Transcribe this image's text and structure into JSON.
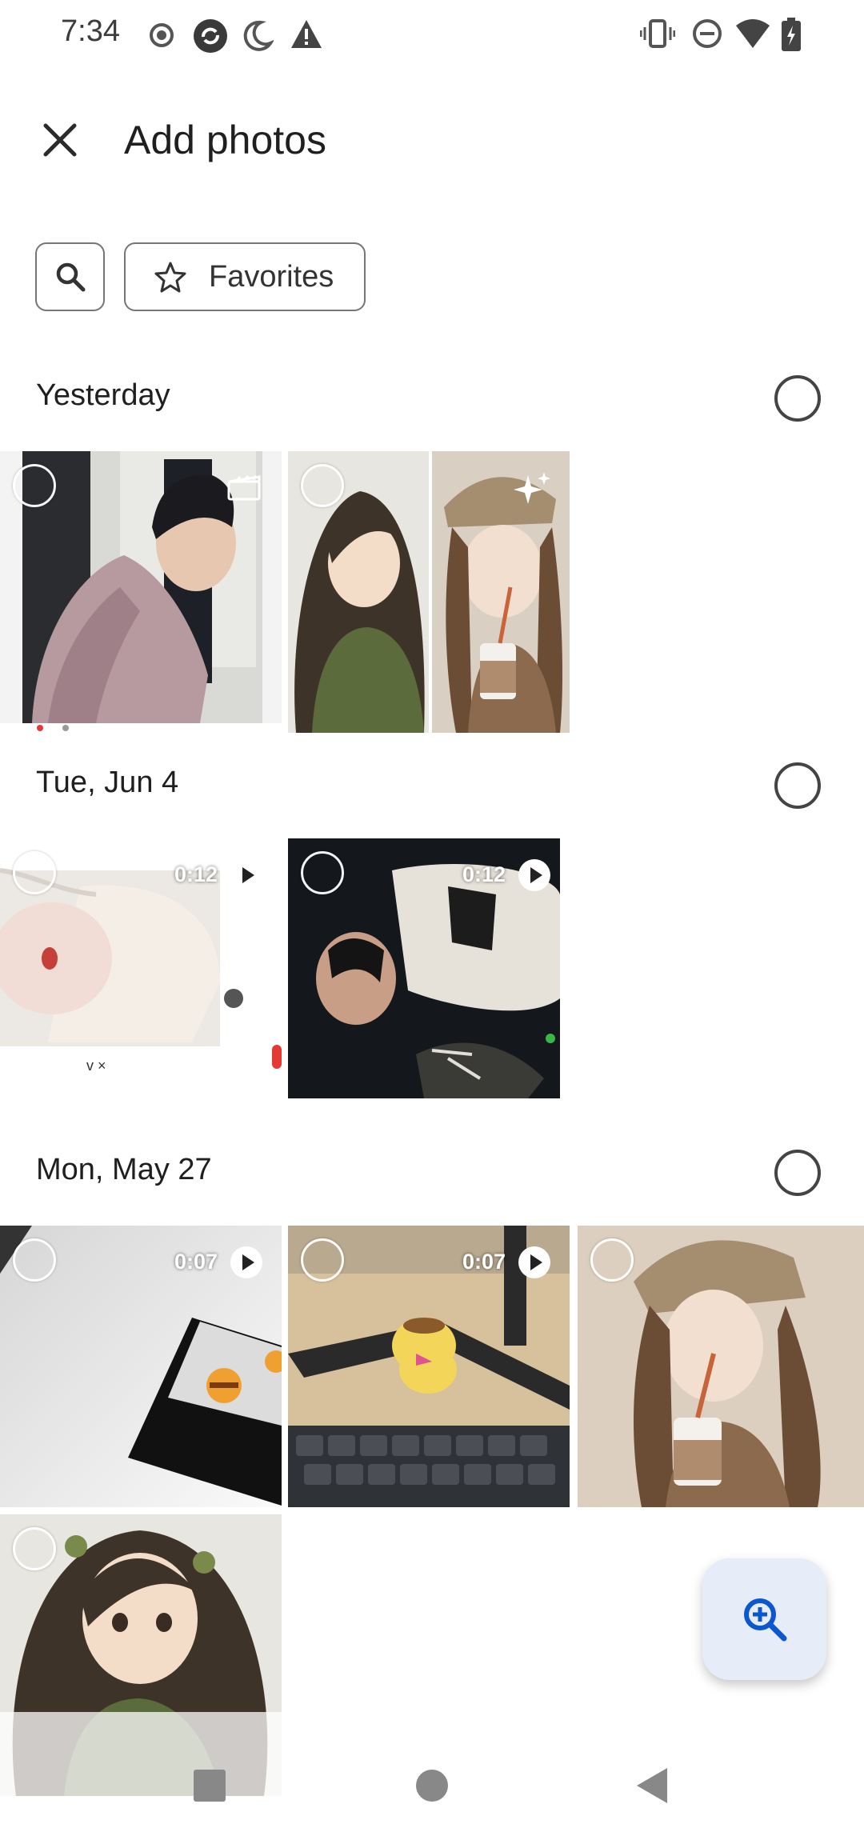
{
  "status_bar": {
    "time": "7:34",
    "left_icons": [
      "record-icon",
      "sync-icon",
      "do-not-disturb-moon-icon",
      "warning-icon"
    ],
    "right_icons": [
      "vibrate-icon",
      "dnd-minus-icon",
      "wifi-icon",
      "battery-charging-icon"
    ]
  },
  "app_bar": {
    "title": "Add photos",
    "close_icon": "close-icon"
  },
  "chips": {
    "search_icon": "search-icon",
    "favorites_label": "Favorites",
    "favorites_icon": "star-outline-icon"
  },
  "sections": [
    {
      "title": "Yesterday",
      "items": [
        {
          "type": "video-clip",
          "duration": "",
          "badge": "movie-clapper-icon",
          "description": "photo"
        },
        {
          "type": "photo",
          "duration": "",
          "badge": "sparkle-icon",
          "description": "collage"
        }
      ]
    },
    {
      "title": "Tue, Jun 4",
      "items": [
        {
          "type": "video",
          "duration": "0:12"
        },
        {
          "type": "video",
          "duration": "0:12"
        }
      ]
    },
    {
      "title": "Mon, May 27",
      "items": [
        {
          "type": "video",
          "duration": "0:07"
        },
        {
          "type": "video",
          "duration": "0:07"
        },
        {
          "type": "photo",
          "duration": ""
        },
        {
          "type": "photo",
          "duration": ""
        }
      ]
    }
  ],
  "fab": {
    "icon": "zoom-in-icon"
  },
  "colors": {
    "accent": "#0b57d0",
    "fab_bg": "#e6ecf8",
    "outline": "#747775"
  }
}
